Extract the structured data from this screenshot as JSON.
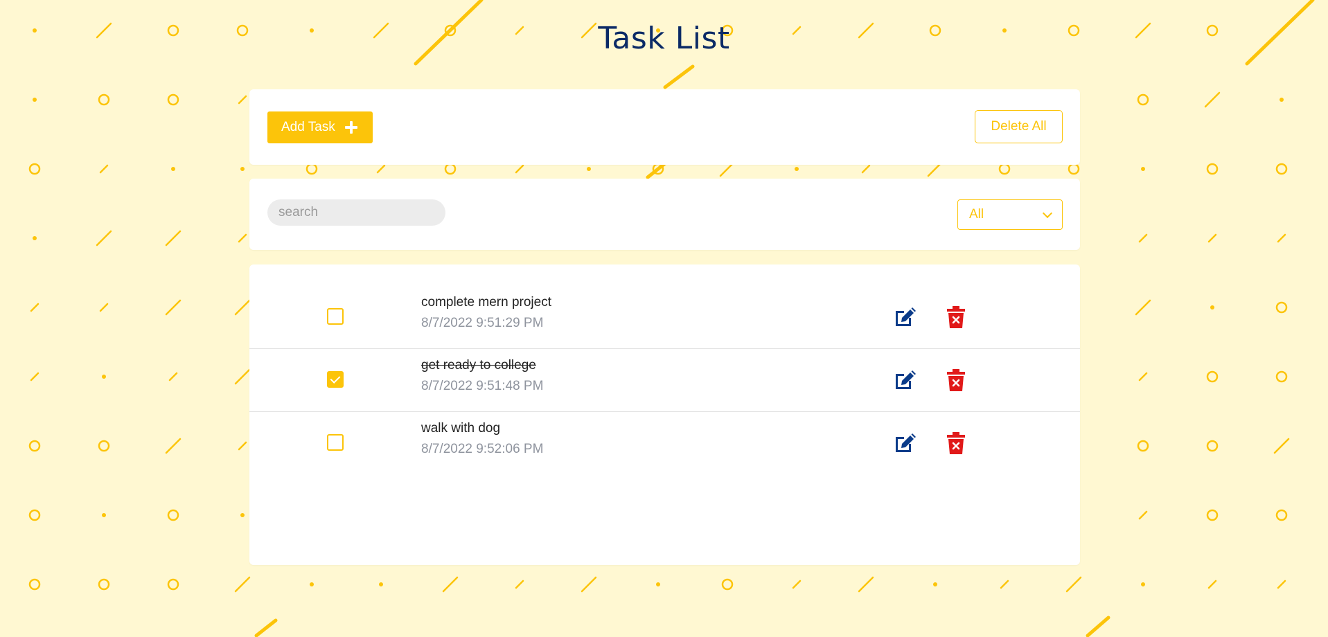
{
  "page": {
    "title": "Task List"
  },
  "colors": {
    "accent": "#fcc40a",
    "title": "#0b2a66",
    "edit_icon": "#0b3c8a",
    "delete_icon": "#e11919",
    "background": "#fff8d2"
  },
  "toolbar": {
    "add_task_label": "Add Task",
    "add_task_icon": "plus-icon",
    "delete_all_label": "Delete All"
  },
  "filter": {
    "search_placeholder": "search",
    "search_value": "",
    "status_selected": "All"
  },
  "tasks": [
    {
      "title": "complete mern project",
      "time": "8/7/2022 9:51:29 PM",
      "completed": false
    },
    {
      "title": "get ready to college",
      "time": "8/7/2022 9:51:48 PM",
      "completed": true
    },
    {
      "title": "walk with dog",
      "time": "8/7/2022 9:52:06 PM",
      "completed": false
    }
  ]
}
